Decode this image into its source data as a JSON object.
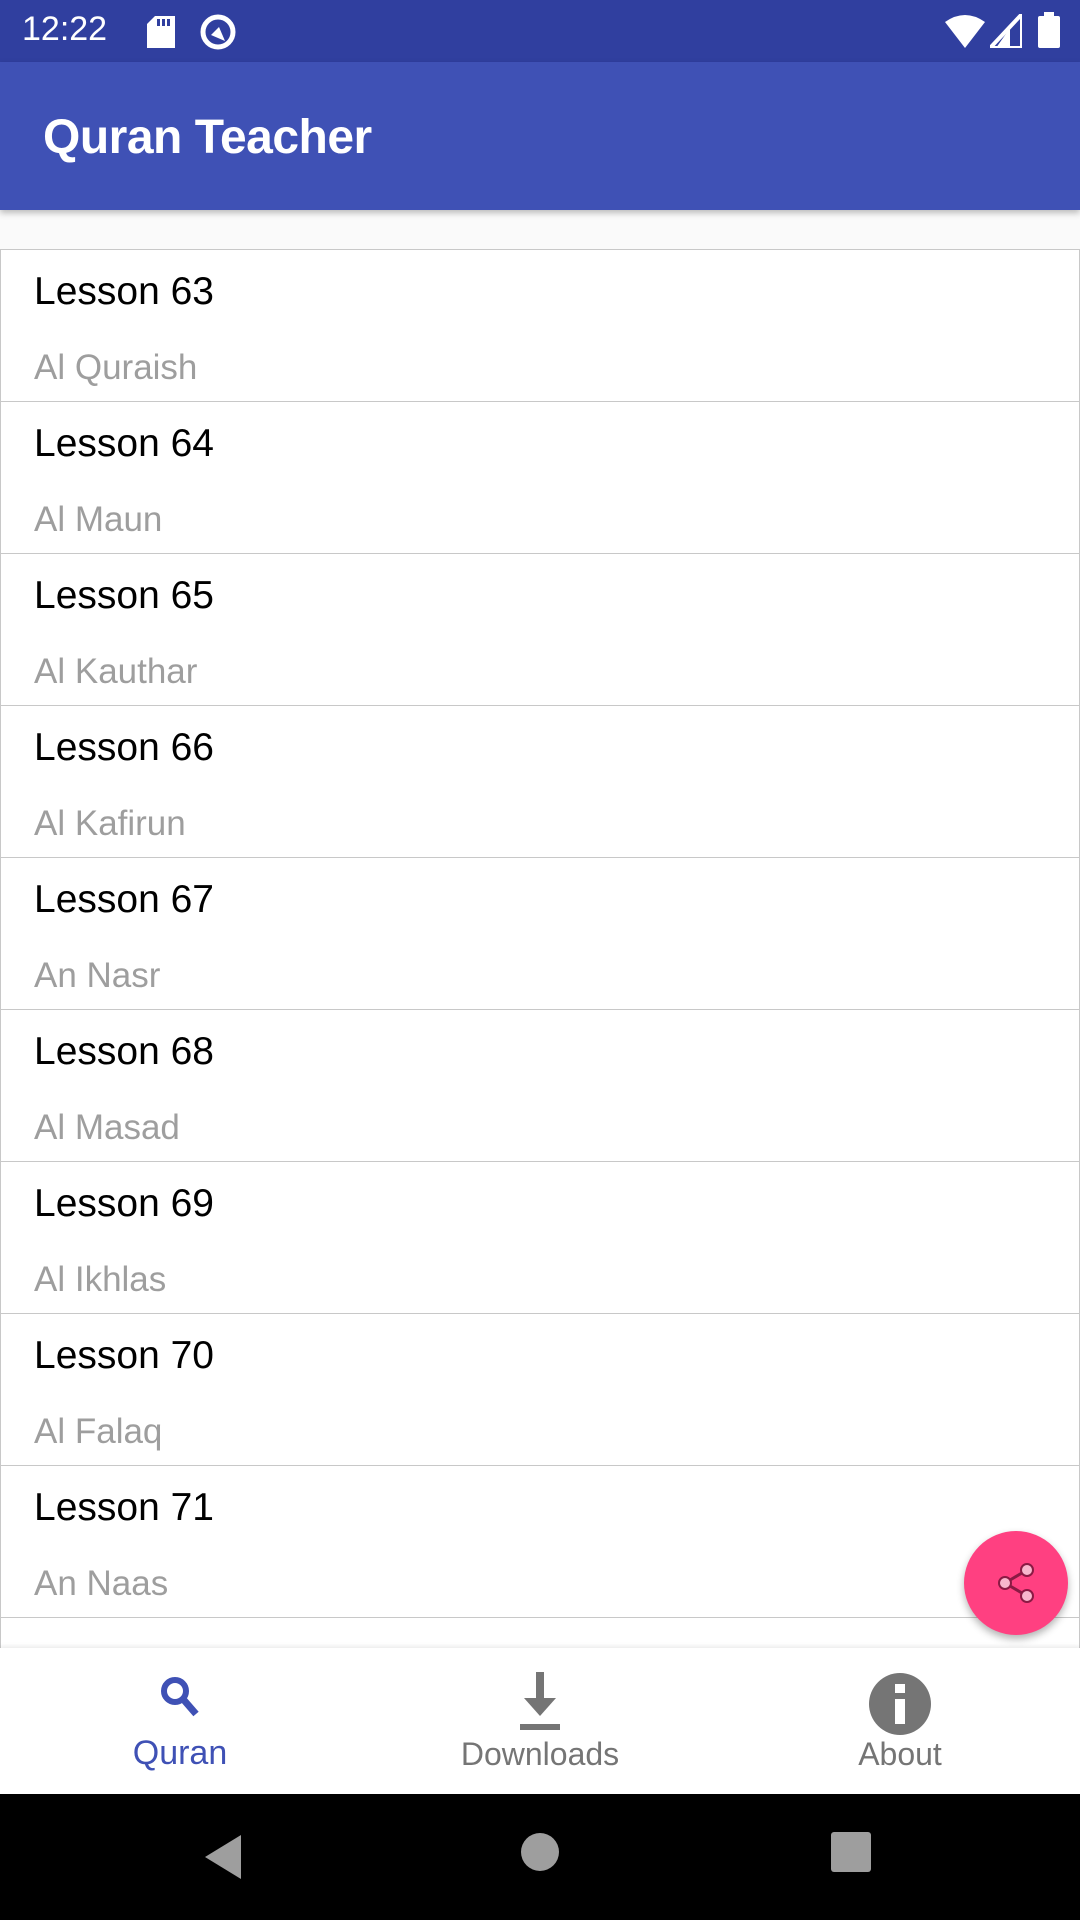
{
  "status_bar": {
    "time": "12:22",
    "icons": [
      "sd-card-icon",
      "sync-icon",
      "wifi-icon",
      "signal-icon",
      "battery-icon"
    ]
  },
  "app_bar": {
    "title": "Quran Teacher"
  },
  "lessons": [
    {
      "title": "Lesson 63",
      "subtitle": "Al Quraish"
    },
    {
      "title": "Lesson 64",
      "subtitle": "Al Maun"
    },
    {
      "title": "Lesson 65",
      "subtitle": "Al Kauthar"
    },
    {
      "title": "Lesson 66",
      "subtitle": "Al Kafirun"
    },
    {
      "title": "Lesson 67",
      "subtitle": "An Nasr"
    },
    {
      "title": "Lesson 68",
      "subtitle": "Al Masad"
    },
    {
      "title": "Lesson 69",
      "subtitle": "Al Ikhlas"
    },
    {
      "title": "Lesson 70",
      "subtitle": "Al Falaq"
    },
    {
      "title": "Lesson 71",
      "subtitle": "An Naas"
    }
  ],
  "fab": {
    "icon": "share-icon",
    "color": "#ff4081"
  },
  "bottom_nav": {
    "active": "Quran",
    "items": [
      {
        "label": "Quran",
        "icon": "search-icon"
      },
      {
        "label": "Downloads",
        "icon": "download-icon"
      },
      {
        "label": "About",
        "icon": "info-icon"
      }
    ]
  },
  "colors": {
    "primary": "#3f51b5",
    "primary_dark": "#303f9f",
    "accent": "#ff4081"
  }
}
